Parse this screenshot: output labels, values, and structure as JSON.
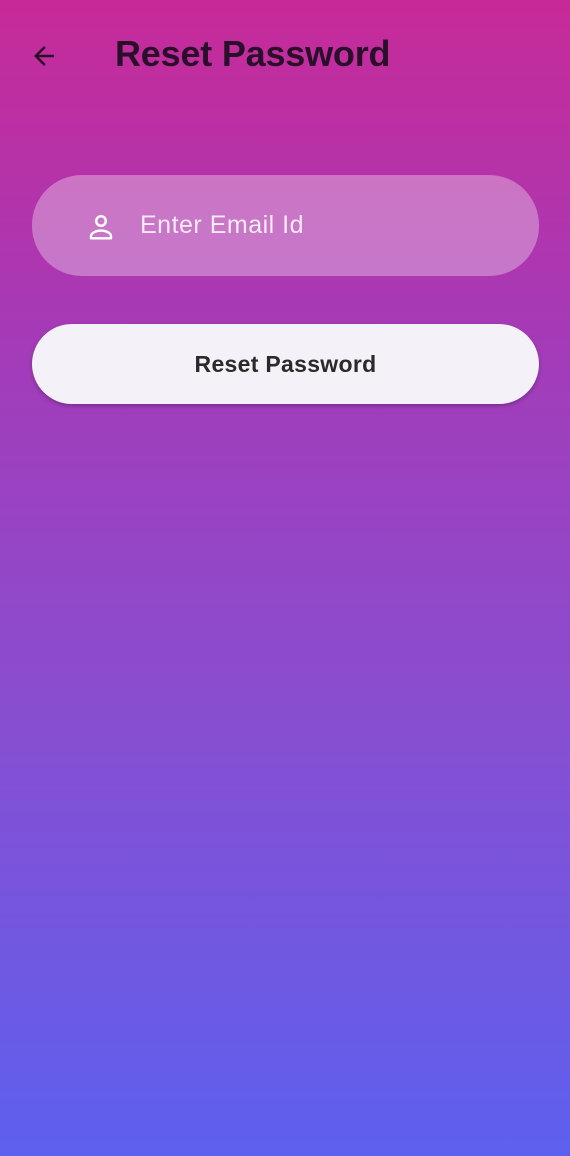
{
  "app_bar": {
    "title": "Reset Password",
    "back_icon": "arrow-left-icon"
  },
  "form": {
    "email": {
      "placeholder": "Enter Email Id",
      "value": "",
      "icon": "person-icon"
    },
    "submit_label": "Reset Password"
  },
  "colors": {
    "gradient_top": "#c72a98",
    "gradient_bottom": "#5d60ef",
    "title_text": "#2a0f2a",
    "button_bg": "#f5f1f9",
    "button_text": "#2a2a2a"
  }
}
